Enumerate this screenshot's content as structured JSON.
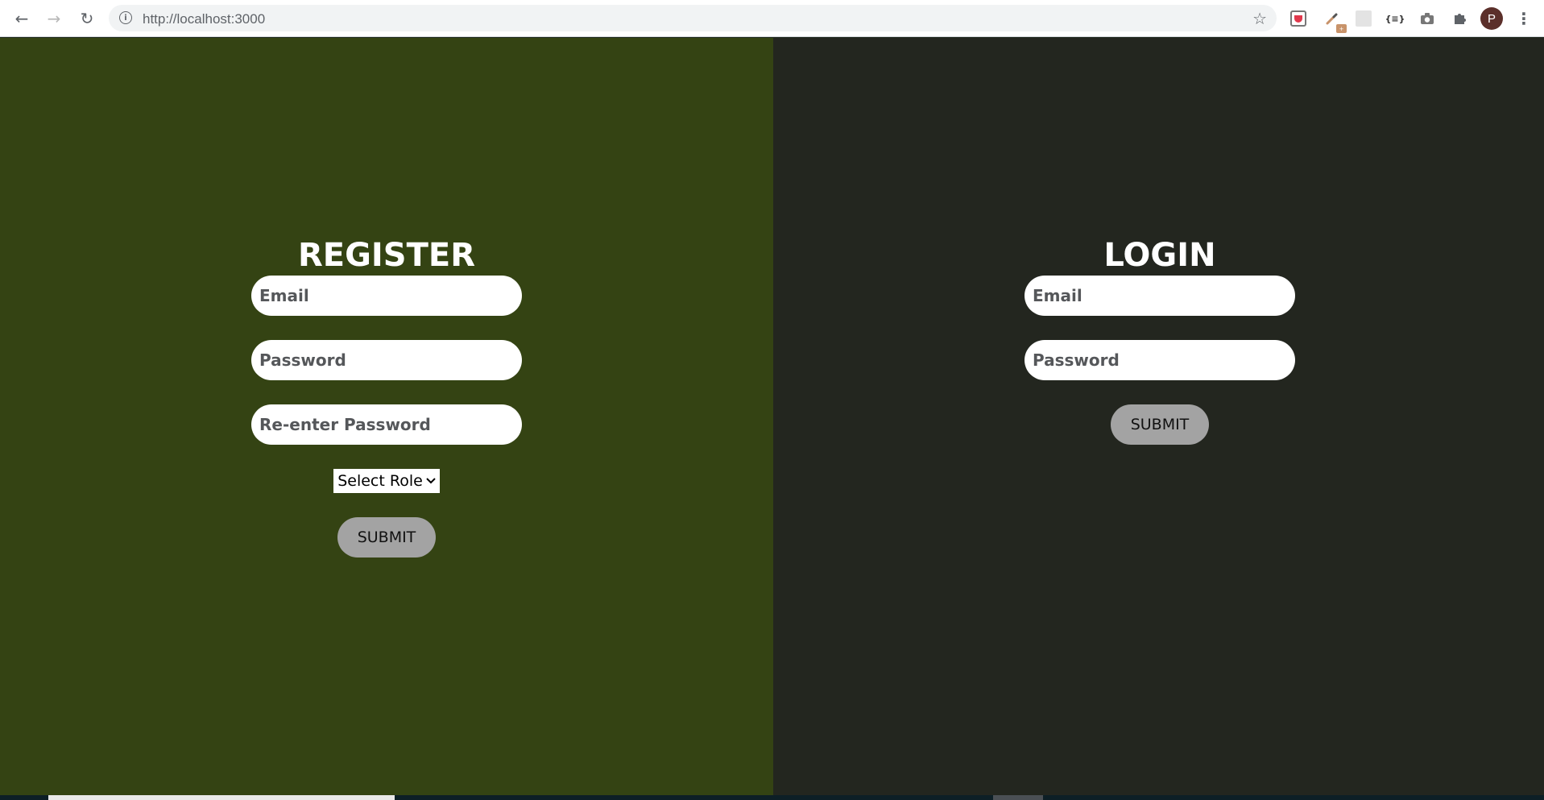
{
  "browser": {
    "url": "http://localhost:3000",
    "back_icon": "←",
    "forward_icon": "→",
    "reload_icon": "↻",
    "info_icon": "i",
    "star_icon": "☆",
    "extensions": {
      "dropper_badge": "+",
      "json_label": "{≡}",
      "camera_icon": "📷",
      "puzzle_icon": "✚"
    },
    "profile_initial": "P",
    "menu_icon": "⋮"
  },
  "register": {
    "title": "REGISTER",
    "email_placeholder": "Email",
    "password_placeholder": "Password",
    "reenter_placeholder": "Re-enter Password",
    "role_select": "Select Role",
    "role_chevron": "⌄",
    "submit_label": "SUBMIT",
    "panel_color": "#344313"
  },
  "login": {
    "title": "LOGIN",
    "email_placeholder": "Email",
    "password_placeholder": "Password",
    "submit_label": "SUBMIT",
    "panel_color": "#23261f"
  }
}
